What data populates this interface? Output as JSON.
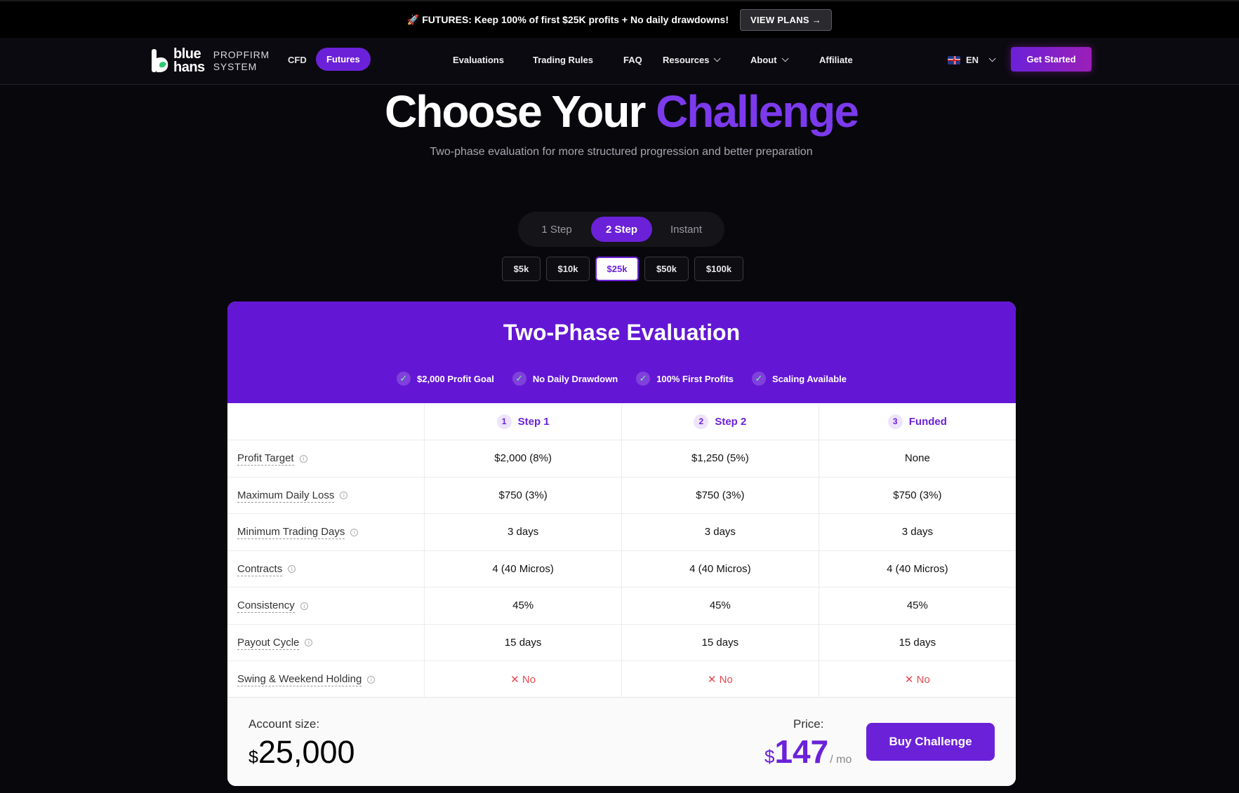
{
  "announcement": {
    "text": "🚀 FUTURES: Keep 100% of first $25K profits + No daily drawdowns!",
    "button": "VIEW PLANS →"
  },
  "nav": {
    "logo_top": "blue",
    "logo_bottom": "hans",
    "logo_sub_1": "PROPFIRM",
    "logo_sub_2": "SYSTEM",
    "modes": [
      "CFD",
      "Futures"
    ],
    "links": [
      "Evaluations",
      "Trading Rules",
      "FAQ",
      "Resources",
      "About",
      "Affiliate"
    ],
    "language": "EN",
    "cta": "Get Started"
  },
  "hero": {
    "title_main": "Choose Your",
    "title_accent": "Challenge",
    "subtitle": "Two-phase evaluation for more structured progression and better preparation"
  },
  "step_options": [
    "1 Step",
    "2 Step",
    "Instant"
  ],
  "sizes": [
    "$5k",
    "$10k",
    "$25k",
    "$50k",
    "$100k"
  ],
  "card": {
    "title": "Two-Phase Evaluation",
    "features": [
      "$2,000 Profit Goal",
      "No Daily Drawdown",
      "100% First Profits",
      "Scaling Available"
    ],
    "phases": [
      {
        "num": "1",
        "label": "Step 1"
      },
      {
        "num": "2",
        "label": "Step 2"
      },
      {
        "num": "3",
        "label": "Funded"
      }
    ],
    "rows": [
      {
        "label": "Profit Target",
        "values": [
          "$2,000 (8%)",
          "$1,250 (5%)",
          "None"
        ]
      },
      {
        "label": "Maximum Daily Loss",
        "values": [
          "$750 (3%)",
          "$750 (3%)",
          "$750 (3%)"
        ]
      },
      {
        "label": "Minimum Trading Days",
        "values": [
          "3 days",
          "3 days",
          "3 days"
        ]
      },
      {
        "label": "Contracts",
        "values": [
          "4 (40 Micros)",
          "4 (40 Micros)",
          "4 (40 Micros)"
        ]
      },
      {
        "label": "Consistency",
        "values": [
          "45%",
          "45%",
          "45%"
        ]
      },
      {
        "label": "Payout Cycle",
        "values": [
          "15 days",
          "15 days",
          "15 days"
        ]
      },
      {
        "label": "Swing & Weekend Holding",
        "values": [
          "✕ No",
          "✕ No",
          "✕ No"
        ]
      }
    ],
    "footer": {
      "account_label": "Account size:",
      "currency": "$",
      "account_value": "25,000",
      "price_label": "Price:",
      "price_value": "147",
      "price_period": "/ mo",
      "buy": "Buy Challenge"
    }
  },
  "colors": {
    "accent": "#6b21d8",
    "background": "#08070c",
    "negative": "#e5484d"
  }
}
